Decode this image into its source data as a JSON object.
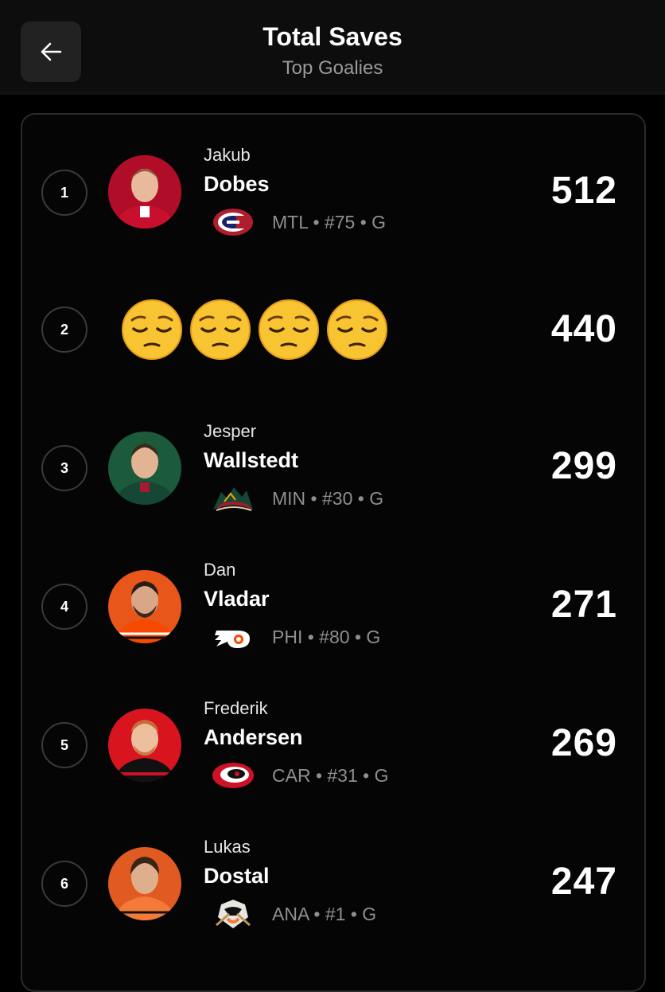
{
  "header": {
    "title": "Total Saves",
    "subtitle": "Top Goalies",
    "back_icon": "arrow-left-icon"
  },
  "rows": [
    {
      "rank": "1",
      "first": "Jakub",
      "last": "Dobes",
      "meta": "MTL • #75 • G",
      "value": "512",
      "team_logo": "canadiens-logo",
      "jersey_color": "#c8102e"
    },
    {
      "rank": "2",
      "emoji": "pensive-face-emoji",
      "emoji_count": 4,
      "value": "440"
    },
    {
      "rank": "3",
      "first": "Jesper",
      "last": "Wallstedt",
      "meta": "MIN • #30 • G",
      "value": "299",
      "team_logo": "wild-logo",
      "jersey_color": "#154734"
    },
    {
      "rank": "4",
      "first": "Dan",
      "last": "Vladar",
      "meta": "PHI • #80 • G",
      "value": "271",
      "team_logo": "flyers-logo",
      "jersey_color": "#f74902"
    },
    {
      "rank": "5",
      "first": "Frederik",
      "last": "Andersen",
      "meta": "CAR • #31 • G",
      "value": "269",
      "team_logo": "hurricanes-logo",
      "jersey_color": "#ce1126"
    },
    {
      "rank": "6",
      "first": "Lukas",
      "last": "Dostal",
      "meta": "ANA • #1 • G",
      "value": "247",
      "team_logo": "ducks-logo",
      "jersey_color": "#f47a38"
    }
  ]
}
